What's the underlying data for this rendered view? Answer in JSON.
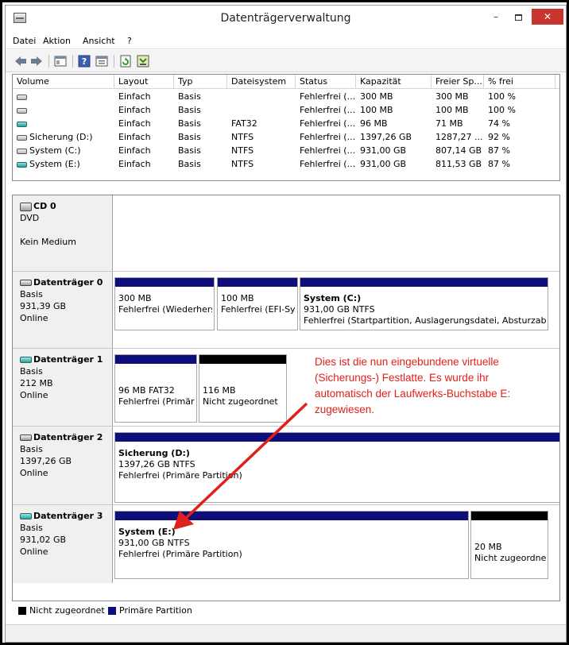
{
  "window": {
    "title": "Datenträgerverwaltung",
    "minimize": "–",
    "close": "✕"
  },
  "menu": [
    "Datei",
    "Aktion",
    "Ansicht",
    "?"
  ],
  "toolbar": {
    "icons": [
      "back-icon",
      "forward-icon",
      "console-tree-icon",
      "help-icon",
      "properties-icon",
      "refresh-icon",
      "export-icon"
    ]
  },
  "volumes": {
    "columns": [
      "Volume",
      "Layout",
      "Typ",
      "Dateisystem",
      "Status",
      "Kapazität",
      "Freier Sp...",
      "% frei"
    ],
    "rows": [
      {
        "icon": "gray",
        "volume": "",
        "layout": "Einfach",
        "typ": "Basis",
        "fs": "",
        "status": "Fehlerfrei (...",
        "cap": "300 MB",
        "free": "300 MB",
        "pct": "100 %"
      },
      {
        "icon": "gray",
        "volume": "",
        "layout": "Einfach",
        "typ": "Basis",
        "fs": "",
        "status": "Fehlerfrei (...",
        "cap": "100 MB",
        "free": "100 MB",
        "pct": "100 %"
      },
      {
        "icon": "teal",
        "volume": "",
        "layout": "Einfach",
        "typ": "Basis",
        "fs": "FAT32",
        "status": "Fehlerfrei (...",
        "cap": "96 MB",
        "free": "71 MB",
        "pct": "74 %"
      },
      {
        "icon": "gray",
        "volume": "Sicherung (D:)",
        "layout": "Einfach",
        "typ": "Basis",
        "fs": "NTFS",
        "status": "Fehlerfrei (...",
        "cap": "1397,26 GB",
        "free": "1287,27 ...",
        "pct": "92 %"
      },
      {
        "icon": "gray",
        "volume": "System (C:)",
        "layout": "Einfach",
        "typ": "Basis",
        "fs": "NTFS",
        "status": "Fehlerfrei (...",
        "cap": "931,00 GB",
        "free": "807,14 GB",
        "pct": "87 %"
      },
      {
        "icon": "teal",
        "volume": "System (E:)",
        "layout": "Einfach",
        "typ": "Basis",
        "fs": "NTFS",
        "status": "Fehlerfrei (...",
        "cap": "931,00 GB",
        "free": "811,53 GB",
        "pct": "87 %"
      }
    ]
  },
  "disks": {
    "cd0": {
      "name": "CD 0",
      "type": "DVD",
      "media": "Kein Medium"
    },
    "d0": {
      "name": "Datenträger 0",
      "type": "Basis",
      "size": "931,39 GB",
      "state": "Online",
      "p1": {
        "size": "300 MB",
        "status": "Fehlerfrei (Wiederherstellungspartition)"
      },
      "p2": {
        "size": "100 MB",
        "status": "Fehlerfrei (EFI-Systempartition)"
      },
      "p3": {
        "title": "System  (C:)",
        "size": "931,00 GB NTFS",
        "status": "Fehlerfrei (Startpartition, Auslagerungsdatei, Absturzabbild)"
      }
    },
    "d1": {
      "name": "Datenträger 1",
      "type": "Basis",
      "size": "212 MB",
      "state": "Online",
      "p1": {
        "size": "96 MB FAT32",
        "status": "Fehlerfrei (Primäre Partition)"
      },
      "p2": {
        "size": "116 MB",
        "status": "Nicht zugeordnet"
      }
    },
    "d2": {
      "name": "Datenträger 2",
      "type": "Basis",
      "size": "1397,26 GB",
      "state": "Online",
      "p1": {
        "title": "Sicherung  (D:)",
        "size": "1397,26 GB NTFS",
        "status": "Fehlerfrei (Primäre Partition)"
      }
    },
    "d3": {
      "name": "Datenträger 3",
      "type": "Basis",
      "size": "931,02 GB",
      "state": "Online",
      "p1": {
        "title": "System  (E:)",
        "size": "931,00 GB NTFS",
        "status": "Fehlerfrei (Primäre Partition)"
      },
      "p2": {
        "size": "20 MB",
        "status": "Nicht zugeordnet"
      }
    }
  },
  "legend": {
    "unallocated": "Nicht zugeordnet",
    "primary": "Primäre Partition"
  },
  "annotation": {
    "lines": [
      "Dies ist die nun eingebundene virtuelle",
      "(Sicherungs-) Festlatte. Es wurde ihr",
      "automatisch der Laufwerks-Buchstabe E:",
      "zugewiesen."
    ],
    "color": "#e0201a"
  },
  "colors": {
    "primary_partition": "#0e0e7a",
    "unallocated": "#000000",
    "close_button": "#c8352f"
  }
}
